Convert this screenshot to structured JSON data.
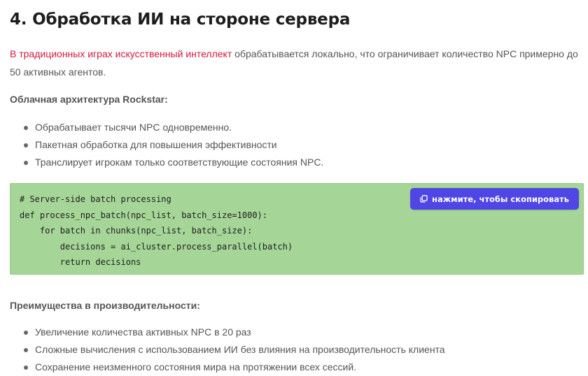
{
  "section": {
    "title": "4. Обработка ИИ на стороне сервера"
  },
  "intro": {
    "link_text": "В традиционных играх искусственный интеллект",
    "rest_text": " обрабатывается локально, что ограничивает количество NPC примерно до 50 активных агентов."
  },
  "cloud": {
    "subheading": "Облачная архитектура Rockstar:",
    "items": [
      "Обрабатывает тысячи NPC одновременно.",
      "Пакетная обработка для повышения эффективности",
      "Транслирует игрокам только соответствующие состояния NPC."
    ]
  },
  "code": {
    "lines": [
      "# Server-side batch processing",
      "def process_npc_batch(npc_list, batch_size=1000):",
      "    for batch in chunks(npc_list, batch_size):",
      "        decisions = ai_cluster.process_parallel(batch)",
      "        return decisions"
    ],
    "copy_label": "нажмите, чтобы скопировать",
    "copy_icon": "copy-icon"
  },
  "performance": {
    "subheading": "Преимущества в производительности:",
    "items": [
      "Увеличение количества активных NPC в 20 раз",
      "Сложные вычисления с использованием ИИ без влияния на производительность клиента",
      "Сохранение неизменного состояния мира на протяжении всех сессий."
    ]
  },
  "colors": {
    "link": "#d4183d",
    "code_background": "#a5d597",
    "copy_button": "#4f46e5"
  }
}
